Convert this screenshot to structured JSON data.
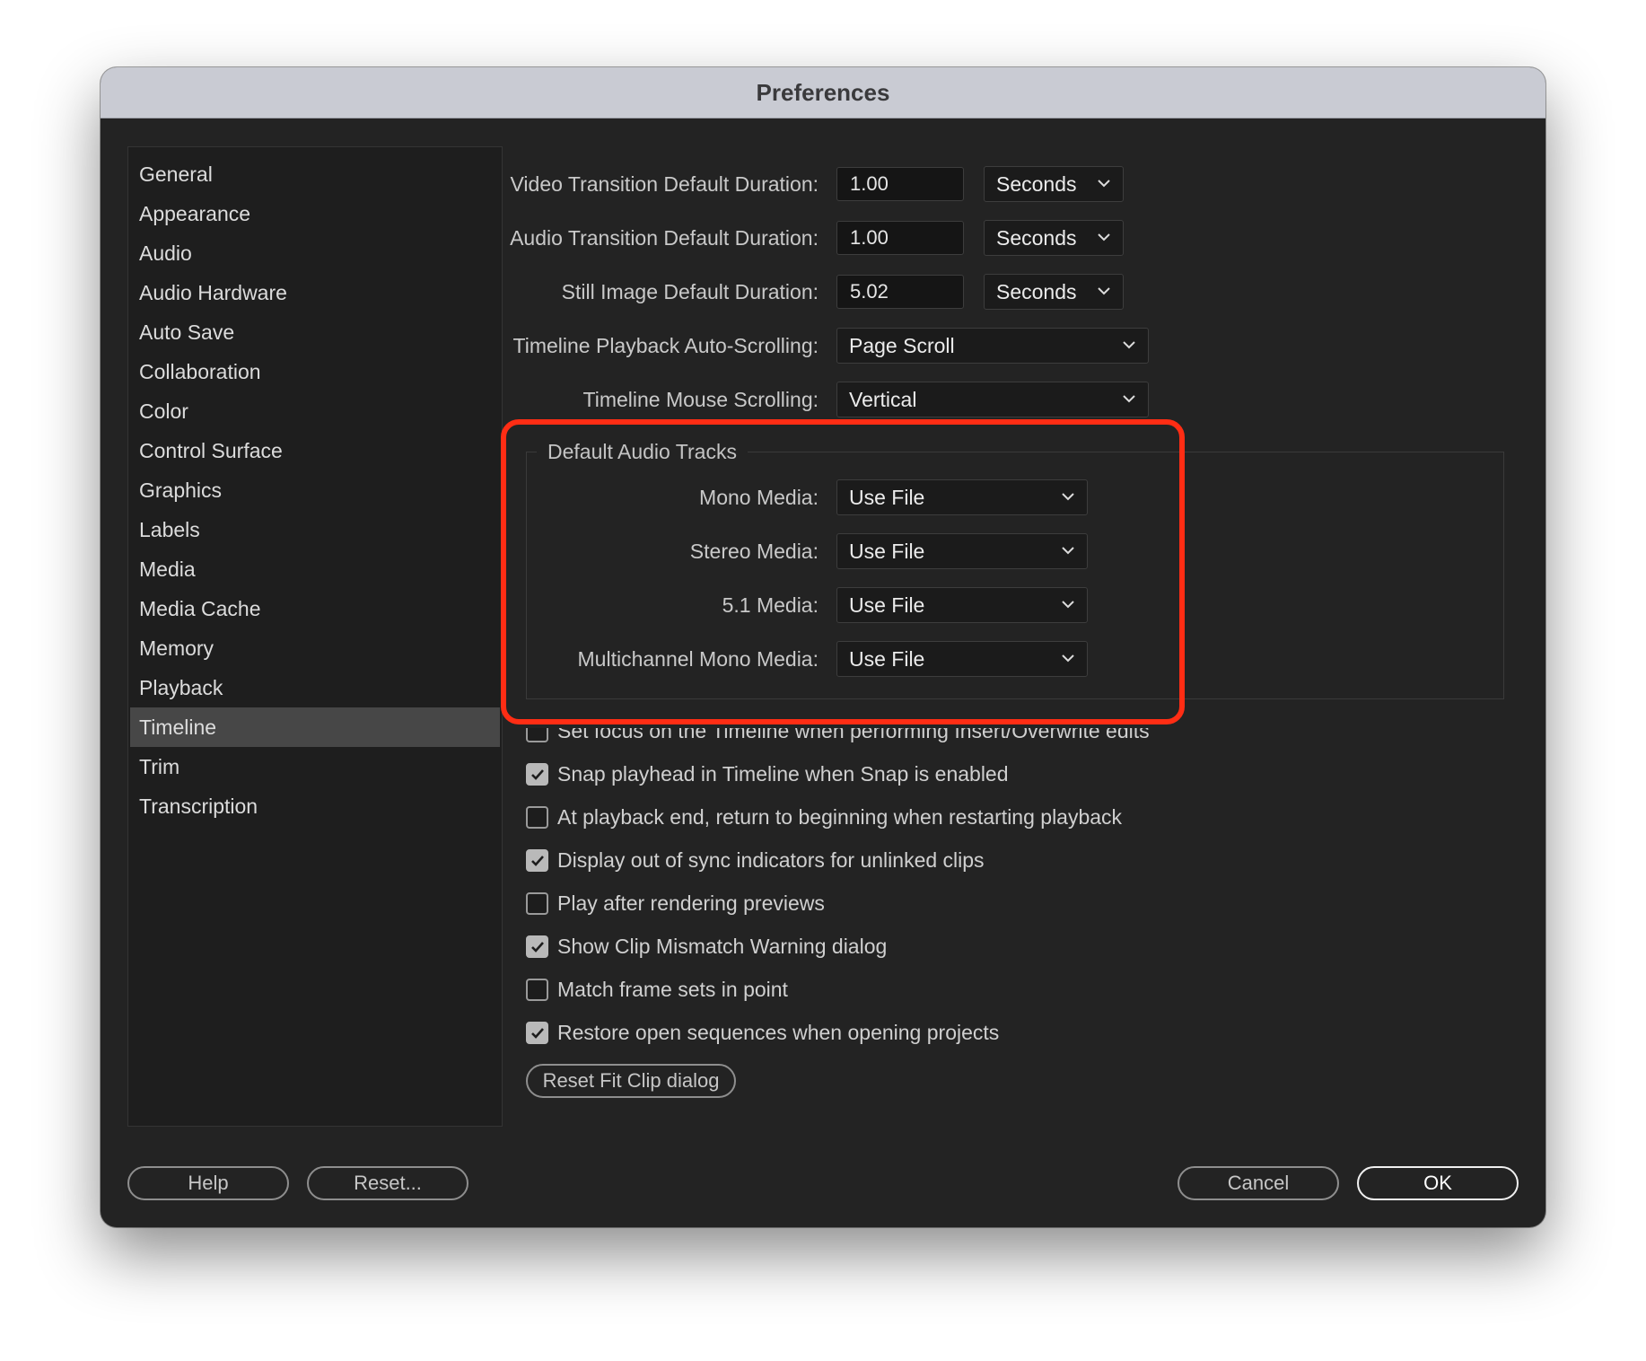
{
  "window": {
    "title": "Preferences"
  },
  "sidebar": {
    "items": [
      {
        "label": "General"
      },
      {
        "label": "Appearance"
      },
      {
        "label": "Audio"
      },
      {
        "label": "Audio Hardware"
      },
      {
        "label": "Auto Save"
      },
      {
        "label": "Collaboration"
      },
      {
        "label": "Color"
      },
      {
        "label": "Control Surface"
      },
      {
        "label": "Graphics"
      },
      {
        "label": "Labels"
      },
      {
        "label": "Media"
      },
      {
        "label": "Media Cache"
      },
      {
        "label": "Memory"
      },
      {
        "label": "Playback"
      },
      {
        "label": "Timeline"
      },
      {
        "label": "Trim"
      },
      {
        "label": "Transcription"
      }
    ],
    "selected": "Timeline"
  },
  "settings": {
    "video_transition": {
      "label": "Video Transition Default Duration:",
      "value": "1.00",
      "unit": "Seconds"
    },
    "audio_transition": {
      "label": "Audio Transition Default Duration:",
      "value": "1.00",
      "unit": "Seconds"
    },
    "still_image": {
      "label": "Still Image Default Duration:",
      "value": "5.02",
      "unit": "Seconds"
    },
    "auto_scrolling": {
      "label": "Timeline Playback Auto-Scrolling:",
      "value": "Page Scroll"
    },
    "mouse_scrolling": {
      "label": "Timeline Mouse Scrolling:",
      "value": "Vertical"
    }
  },
  "audio_tracks": {
    "title": "Default Audio Tracks",
    "mono": {
      "label": "Mono Media:",
      "value": "Use File"
    },
    "stereo": {
      "label": "Stereo Media:",
      "value": "Use File"
    },
    "surround": {
      "label": "5.1 Media:",
      "value": "Use File"
    },
    "multichannel": {
      "label": "Multichannel Mono Media:",
      "value": "Use File"
    }
  },
  "checkboxes": [
    {
      "label": "Set focus on the Timeline when performing Insert/Overwrite edits",
      "checked": false
    },
    {
      "label": "Snap playhead in Timeline when Snap is enabled",
      "checked": true
    },
    {
      "label": "At playback end, return to beginning when restarting playback",
      "checked": false
    },
    {
      "label": "Display out of sync indicators for unlinked clips",
      "checked": true
    },
    {
      "label": "Play after rendering previews",
      "checked": false
    },
    {
      "label": "Show Clip Mismatch Warning dialog",
      "checked": true
    },
    {
      "label": "Match frame sets in point",
      "checked": false
    },
    {
      "label": "Restore open sequences when opening projects",
      "checked": true
    }
  ],
  "buttons": {
    "reset_fit_clip": "Reset Fit Clip dialog",
    "help": "Help",
    "reset": "Reset...",
    "cancel": "Cancel",
    "ok": "OK"
  },
  "colors": {
    "highlight": "#ff2d14",
    "background": "#232323",
    "titlebar": "#c9cbd3"
  }
}
